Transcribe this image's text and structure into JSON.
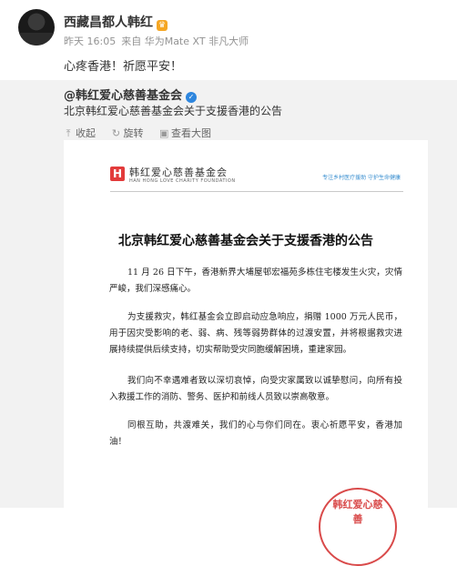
{
  "post": {
    "author": "西藏昌都人韩红",
    "time": "昨天 16:05",
    "source": "来自 华为Mate XT 非凡大师",
    "content": "心疼香港！祈愿平安！"
  },
  "repost": {
    "author": "@韩红爱心慈善基金会",
    "text": "北京韩红爱心慈善基金会关于支援香港的公告",
    "toolbar": {
      "collapse": "收起",
      "rotate": "旋转",
      "view_large": "查看大图"
    }
  },
  "document": {
    "logo_mark": "H",
    "logo_cn": "韩红爱心慈善基金会",
    "logo_en": "HAN HONG LOVE CHARITY FOUNDATION",
    "slogan": "专注乡村医疗援助 守护生命健康",
    "title": "北京韩红爱心慈善基金会关于支援香港的公告",
    "paragraphs": [
      "11 月 26 日下午，香港新界大埔屋邨宏福苑多栋住宅楼发生火灾，灾情严峻，我们深感痛心。",
      "为支援救灾，韩红基金会立即启动应急响应，捐赠 1000 万元人民币，用于因灾受影响的老、弱、病、残等弱势群体的过渡安置，并将根据救灾进展持续提供后续支持，切实帮助受灾同胞缓解困境，重建家园。",
      "我们向不幸遇难者致以深切哀悼，向受灾家属致以诚挚慰问，向所有投入救援工作的消防、警务、医护和前线人员致以崇高敬意。",
      "同根互助，共渡难关，我们的心与你们同在。衷心祈愿平安，香港加油！"
    ],
    "seal_text": "韩红爱心慈善"
  },
  "colors": {
    "accent_blue": "#2e86de",
    "brand_red": "#e23b3b",
    "vip_gold": "#f5a623"
  }
}
